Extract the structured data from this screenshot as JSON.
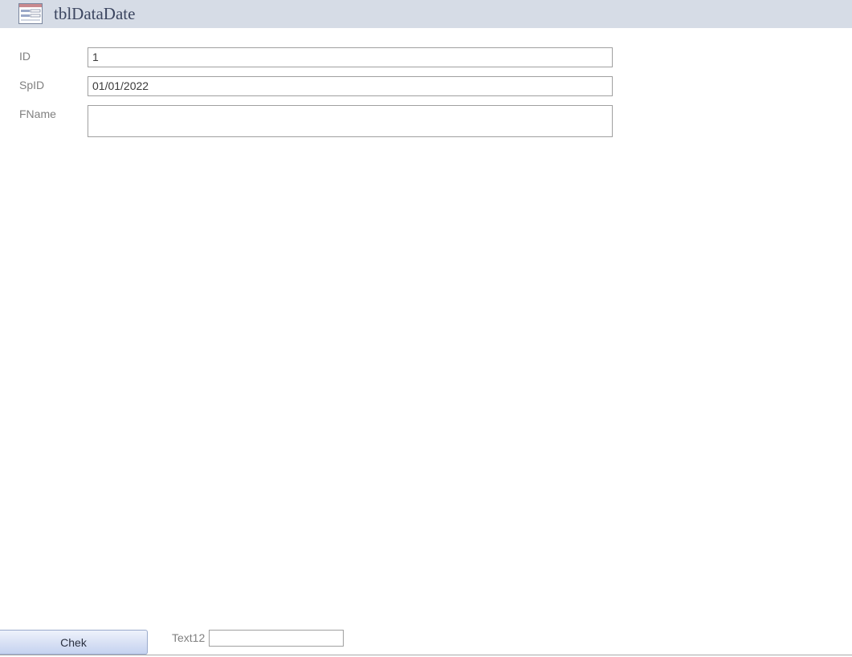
{
  "form": {
    "title": "tblDataDate",
    "icon": "form-icon"
  },
  "fields": [
    {
      "label": "ID",
      "value": "1"
    },
    {
      "label": "SpID",
      "value": "01/01/2022"
    },
    {
      "label": "FName",
      "value": ""
    }
  ],
  "footer": {
    "button_label": "Chek",
    "text12_label": "Text12",
    "text12_value": ""
  },
  "colors": {
    "header_bg": "#d6dce6",
    "title_text": "#3c4660",
    "label_text": "#808080",
    "input_border": "#a0a0a0",
    "button_gradient_top": "#eef2fb",
    "button_gradient_bottom": "#c5d2f0"
  }
}
